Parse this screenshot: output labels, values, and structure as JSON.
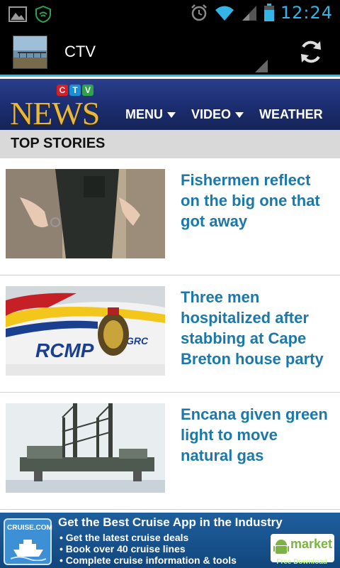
{
  "status_bar": {
    "time": "12:24",
    "icons": [
      "picture-notification-icon",
      "shield-icon",
      "alarm-icon",
      "wifi-icon",
      "signal-icon",
      "battery-icon"
    ]
  },
  "action_bar": {
    "title": "CTV",
    "accent_color": "#33b5e5"
  },
  "header": {
    "logo_letters": [
      "C",
      "T",
      "V"
    ],
    "logo_word": "NEWS",
    "nav": [
      {
        "label": "MENU",
        "dropdown": true
      },
      {
        "label": "VIDEO",
        "dropdown": true
      },
      {
        "label": "WEATHER",
        "dropdown": false
      }
    ]
  },
  "section": {
    "title": "TOP STORIES"
  },
  "stories": [
    {
      "headline": "Fishermen reflect on the big one that got away",
      "thumb": "fisherman-hands-image"
    },
    {
      "headline": "Three men hospitalized after stabbing at Cape Breton house party",
      "thumb": "rcmp-car-image"
    },
    {
      "headline": "Encana given green light to move natural gas",
      "thumb": "gas-rig-image"
    }
  ],
  "ad": {
    "logo_text": "CRUISE.COM",
    "title": "Get the Best Cruise App in the Industry",
    "bullets": [
      "Get the latest cruise deals",
      "Book over 40 cruise lines",
      "Complete cruise information & tools"
    ],
    "badge": "market",
    "badge_sub": "Free Download"
  }
}
